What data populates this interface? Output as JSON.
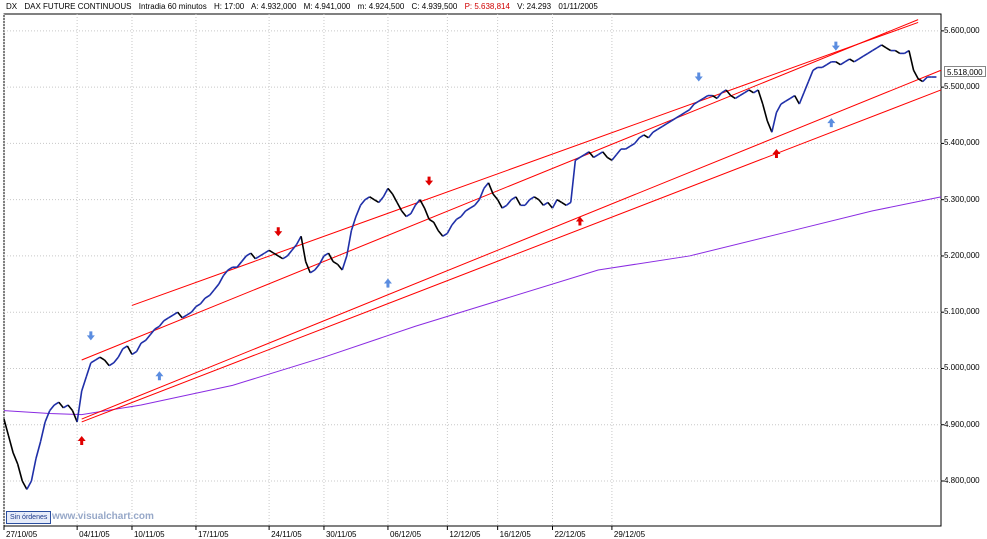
{
  "header": {
    "symbol": "DX",
    "name": "DAX FUTURE CONTINUOUS",
    "timeframe": "Intradia 60 minutos",
    "hour": "H: 17:00",
    "open": "A: 4.932,000",
    "high": "M: 4.941,000",
    "low": "m: 4.924,500",
    "close": "C: 4.939,500",
    "price": "P: 5.638,814",
    "volume": "V: 24.293",
    "date": "01/11/2005"
  },
  "last_price_label": "5.518,000",
  "sin_ordenes_label": "Sin órdenes",
  "watermark": "www.visualchart.com",
  "colors": {
    "up_series": "#1f2fa8",
    "down_series": "#000000",
    "channel": "#ff0000",
    "moving_average": "#8a2be2",
    "arrow_up_red": "#e00000",
    "arrow_down_blue": "#5b8de0",
    "grid": "#c8c8c8"
  },
  "chart_data": {
    "type": "line",
    "title": "DAX FUTURE CONTINUOUS",
    "x_tick_labels": [
      "27/10/05",
      "04/11/05",
      "10/11/05",
      "17/11/05",
      "24/11/05",
      "30/11/05",
      "06/12/05",
      "12/12/05",
      "16/12/05",
      "22/12/05",
      "29/12/05"
    ],
    "y_tick_labels": [
      "5.600,000",
      "5.500,000",
      "5.400,000",
      "5.300,000",
      "5.200,000",
      "5.100,000",
      "5.000,000",
      "4.900,000",
      "4.800,000"
    ],
    "ylim": [
      4720,
      5630
    ],
    "xlim": [
      0,
      205
    ],
    "grid": true,
    "x_tick_positions": [
      0,
      16,
      28,
      42,
      58,
      70,
      84,
      97,
      108,
      120,
      133
    ],
    "series": [
      {
        "x": [
          0,
          1,
          2,
          3,
          4,
          5,
          6,
          7,
          8,
          9,
          10,
          11,
          12,
          13,
          14,
          15,
          16,
          17,
          18,
          19,
          20,
          21,
          22,
          23,
          24,
          25,
          26,
          27,
          28,
          29,
          30,
          31,
          32,
          33,
          34,
          35,
          36,
          37,
          38,
          39,
          40,
          41,
          42,
          43,
          44,
          45,
          46,
          47,
          48,
          49,
          50,
          51,
          52,
          53,
          54,
          55,
          56,
          57,
          58,
          59,
          60,
          61,
          62,
          63,
          64,
          65,
          66,
          67,
          68,
          69,
          70,
          71,
          72,
          73,
          74,
          75,
          76,
          77,
          78,
          79,
          80,
          81,
          82,
          83,
          84,
          85,
          86,
          87,
          88,
          89,
          90,
          91,
          92,
          93,
          94,
          95,
          96,
          97,
          98,
          99,
          100,
          101,
          102,
          103,
          104,
          105,
          106,
          107,
          108,
          109,
          110,
          111,
          112,
          113,
          114,
          115,
          116,
          117,
          118,
          119,
          120,
          121,
          122,
          123,
          124,
          125,
          126,
          127,
          128,
          129,
          130,
          131,
          132,
          133,
          134,
          135,
          136,
          137,
          138,
          139,
          140,
          141,
          142,
          143,
          144,
          145,
          146,
          147,
          148,
          149,
          150,
          151,
          152,
          153,
          154,
          155,
          156,
          157,
          158,
          159,
          160,
          161,
          162,
          163,
          164,
          165,
          166,
          167,
          168,
          169,
          170,
          171,
          172,
          173,
          174,
          175,
          176,
          177,
          178,
          179,
          180,
          181,
          182,
          183,
          184,
          185,
          186,
          187,
          188,
          189,
          190,
          191,
          192,
          193,
          194,
          195,
          196,
          197,
          198,
          199,
          200,
          201,
          202,
          203,
          204
        ],
        "close": [
          4910,
          4880,
          4850,
          4830,
          4800,
          4785,
          4800,
          4840,
          4870,
          4905,
          4925,
          4935,
          4940,
          4930,
          4935,
          4925,
          4905,
          4960,
          4985,
          5010,
          5015,
          5020,
          5015,
          5005,
          5010,
          5020,
          5035,
          5040,
          5025,
          5030,
          5045,
          5050,
          5060,
          5070,
          5075,
          5085,
          5090,
          5095,
          5100,
          5090,
          5095,
          5100,
          5110,
          5115,
          5125,
          5130,
          5140,
          5150,
          5165,
          5175,
          5180,
          5180,
          5190,
          5200,
          5205,
          5195,
          5200,
          5205,
          5210,
          5205,
          5200,
          5195,
          5200,
          5210,
          5220,
          5235,
          5190,
          5170,
          5175,
          5185,
          5200,
          5205,
          5190,
          5185,
          5175,
          5200,
          5245,
          5270,
          5290,
          5300,
          5305,
          5300,
          5295,
          5305,
          5320,
          5310,
          5295,
          5280,
          5270,
          5275,
          5290,
          5300,
          5285,
          5265,
          5260,
          5245,
          5235,
          5240,
          5255,
          5265,
          5270,
          5280,
          5285,
          5290,
          5300,
          5320,
          5330,
          5310,
          5300,
          5285,
          5290,
          5300,
          5305,
          5290,
          5290,
          5300,
          5305,
          5300,
          5290,
          5295,
          5285,
          5300,
          5295,
          5290,
          5295,
          5370,
          5375,
          5380,
          5385,
          5375,
          5380,
          5385,
          5375,
          5370,
          5380,
          5390,
          5390,
          5395,
          5400,
          5410,
          5415,
          5410,
          5420,
          5425,
          5430,
          5435,
          5440,
          5445,
          5450,
          5455,
          5460,
          5470,
          5475,
          5480,
          5485,
          5485,
          5480,
          5490,
          5495,
          5485,
          5480,
          5485,
          5490,
          5495,
          5490,
          5495,
          5470,
          5440,
          5420,
          5455,
          5470,
          5475,
          5480,
          5485,
          5470,
          5490,
          5510,
          5530,
          5535,
          5535,
          5540,
          5545,
          5545,
          5540,
          5545,
          5550,
          5545,
          5550,
          5555,
          5560,
          5565,
          5570,
          5575,
          5570,
          5565,
          5565,
          5560,
          5560,
          5565,
          5530,
          5515,
          5510,
          5518,
          5518,
          5518
        ]
      }
    ],
    "channel_lines": [
      {
        "x": [
          17,
          200
        ],
        "y": [
          5015,
          5620
        ]
      },
      {
        "x": [
          28,
          200
        ],
        "y": [
          5112,
          5615
        ]
      },
      {
        "x": [
          17,
          205
        ],
        "y": [
          4910,
          5530
        ]
      },
      {
        "x": [
          17,
          205
        ],
        "y": [
          4905,
          5495
        ]
      }
    ],
    "moving_average": {
      "x": [
        0,
        10,
        17,
        30,
        50,
        70,
        90,
        110,
        130,
        150,
        170,
        190,
        205
      ],
      "y": [
        4925,
        4920,
        4918,
        4935,
        4970,
        5020,
        5075,
        5125,
        5175,
        5200,
        5240,
        5280,
        5305
      ]
    },
    "arrows_up": [
      {
        "x": 17,
        "y": 4880
      },
      {
        "x": 34,
        "y": 4995
      },
      {
        "x": 84,
        "y": 5160
      },
      {
        "x": 126,
        "y": 5270
      },
      {
        "x": 169,
        "y": 5390
      },
      {
        "x": 181,
        "y": 5445
      }
    ],
    "arrows_down": [
      {
        "x": 19,
        "y": 5050
      },
      {
        "x": 60,
        "y": 5235
      },
      {
        "x": 93,
        "y": 5325
      },
      {
        "x": 152,
        "y": 5510
      },
      {
        "x": 182,
        "y": 5565
      }
    ]
  }
}
